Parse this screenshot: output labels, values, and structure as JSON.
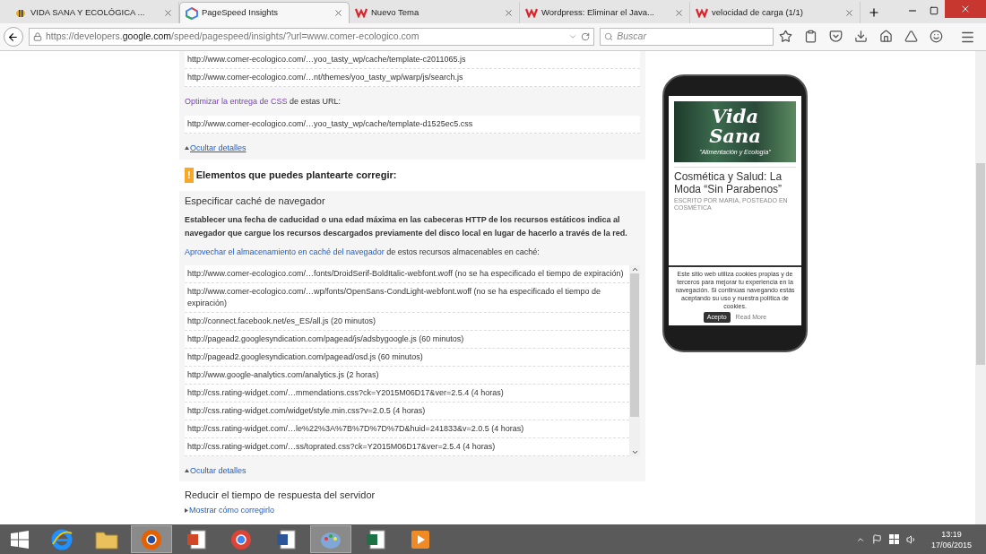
{
  "tabs": [
    {
      "label": "VIDA SANA Y ECOLÓGICA ...",
      "selected": false,
      "kind": "bee"
    },
    {
      "label": "PageSpeed Insights",
      "selected": true,
      "kind": "pagespeed"
    },
    {
      "label": "Nuevo Tema",
      "selected": false,
      "kind": "w"
    },
    {
      "label": "Wordpress: Eliminar el Java...",
      "selected": false,
      "kind": "w"
    },
    {
      "label": "velocidad de carga (1/1)",
      "selected": false,
      "kind": "w"
    }
  ],
  "address": {
    "prefix": "https://developers.",
    "domain": "google.com",
    "rest": "/speed/pagespeed/insights/?url=www.comer-ecologico.com"
  },
  "search": {
    "placeholder": "Buscar"
  },
  "top_urls": [
    "http://www.comer-ecologico.com/…yoo_tasty_wp/cache/template-c2011065.js",
    "http://www.comer-ecologico.com/…nt/themes/yoo_tasty_wp/warp/js/search.js"
  ],
  "css_intro": {
    "link": "Optimizar la entrega de CSS",
    "text": " de estas URL:"
  },
  "css_urls": [
    "http://www.comer-ecologico.com/…yoo_tasty_wp/cache/template-d1525ec5.css"
  ],
  "hide_details_1": "Ocultar detalles",
  "consider_heading": {
    "badge": "!",
    "title": "Elementos que puedes plantearte corregir:"
  },
  "cache_rule": {
    "title": "Especificar caché de navegador",
    "description": "Establecer una fecha de caducidad o una edad máxima en las cabeceras HTTP de los recursos estáticos indica al navegador que cargue los recursos descargados previamente del disco local en lugar de hacerlo a través de la red.",
    "intro_link": "Aprovechar el almacenamiento en caché del navegador",
    "intro_text": " de estos recursos almacenables en caché:",
    "urls": [
      "http://www.comer-ecologico.com/…fonts/DroidSerif-BoldItalic-webfont.woff (no se ha especificado el tiempo de expiración)",
      "http://www.comer-ecologico.com/…wp/fonts/OpenSans-CondLight-webfont.woff (no se ha especificado el tiempo de expiración)",
      "http://connect.facebook.net/es_ES/all.js (20 minutos)",
      "http://pagead2.googlesyndication.com/pagead/js/adsbygoogle.js (60 minutos)",
      "http://pagead2.googlesyndication.com/pagead/osd.js (60 minutos)",
      "http://www.google-analytics.com/analytics.js (2 horas)",
      "http://css.rating-widget.com/…mmendations.css?ck=Y2015M06D17&ver=2.5.4 (4 horas)",
      "http://css.rating-widget.com/widget/style.min.css?v=2.0.5 (4 horas)",
      "http://css.rating-widget.com/…le%22%3A%7B%7D%7D%7D&huid=241833&v=2.0.5 (4 horas)",
      "http://css.rating-widget.com/…ss/toprated.css?ck=Y2015M06D17&ver=2.5.4 (4 horas)"
    ],
    "hide_details": "Ocultar detalles"
  },
  "response_rule": {
    "title": "Reducir el tiempo de respuesta del servidor",
    "show_link": "Mostrar cómo corregirlo"
  },
  "phone": {
    "banner_title_1": "Vida",
    "banner_title_2": "Sana",
    "banner_subtitle": "\"Alimentación y Ecología\"",
    "post_title": "Cosmética y Salud: La Moda “Sin Parabenos”",
    "byline": "ESCRITO POR MARIA, POSTEADO EN COSMÉTICA",
    "cookie_text": "Este sitio web utiliza cookies propias y de terceros para mejorar tu experiencia en la navegación. Si continúas navegando estás aceptando su uso y nuestra política de cookies.",
    "accept": "Acepto",
    "read_more": "Read More"
  },
  "taskbar": {
    "apps": [
      {
        "kind": "ie",
        "selected": false
      },
      {
        "kind": "folder",
        "selected": false
      },
      {
        "kind": "firefox",
        "selected": true
      },
      {
        "kind": "powerpoint",
        "selected": false
      },
      {
        "kind": "chrome",
        "selected": false
      },
      {
        "kind": "word",
        "selected": false
      },
      {
        "kind": "paint",
        "selected": true
      },
      {
        "kind": "excel",
        "selected": false
      },
      {
        "kind": "media",
        "selected": false
      }
    ],
    "time": "13:19",
    "date": "17/06/2015"
  }
}
